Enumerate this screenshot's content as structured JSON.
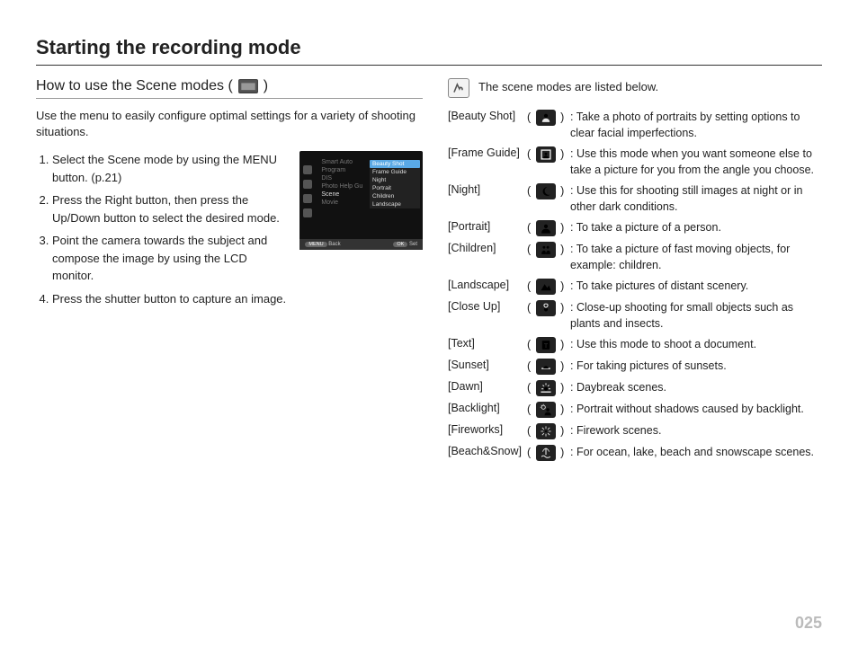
{
  "page_title": "Starting the recording mode",
  "page_number": "025",
  "left": {
    "subheading_prefix": "How to use the Scene modes (",
    "subheading_suffix": ")",
    "intro": "Use the menu to easily configure optimal settings for a variety of shooting situations.",
    "steps": [
      "Select the Scene mode by using the MENU button. (p.21)",
      "Press the Right button, then press the Up/Down button to select the desired mode.",
      "Point the camera towards the subject and compose the image by using the LCD monitor.",
      "Press the shutter button to capture an image."
    ],
    "menu_screenshot": {
      "left_list": [
        "Smart Auto",
        "Program",
        "DIS",
        "Photo Help Gu",
        "Scene",
        "Movie"
      ],
      "left_highlight": "Scene",
      "sub_list": [
        "Beauty Shot",
        "Frame Guide",
        "Night",
        "Portrait",
        "Children",
        "Landscape"
      ],
      "sub_selected": "Beauty Shot",
      "footer_left_btn": "MENU",
      "footer_left": "Back",
      "footer_right_btn": "OK",
      "footer_right": "Set"
    }
  },
  "right": {
    "note": "The scene modes are listed below.",
    "rows": [
      {
        "label": "[Beauty Shot]",
        "icon": "beauty",
        "desc": "Take a photo of portraits by setting options to clear facial imperfections."
      },
      {
        "label": "[Frame Guide]",
        "icon": "frame",
        "desc": "Use this mode when you want someone else to take a picture for you from the angle you choose."
      },
      {
        "label": "[Night]",
        "icon": "night",
        "desc": "Use this for shooting still images at night or in other dark conditions."
      },
      {
        "label": "[Portrait]",
        "icon": "portrait",
        "desc": "To take a picture of a person."
      },
      {
        "label": "[Children]",
        "icon": "children",
        "desc": "To take a picture of fast moving objects, for example: children."
      },
      {
        "label": "[Landscape]",
        "icon": "landscape",
        "desc": "To take pictures of distant scenery."
      },
      {
        "label": "[Close Up]",
        "icon": "closeup",
        "desc": "Close-up shooting for small objects such as plants and insects."
      },
      {
        "label": "[Text]",
        "icon": "text",
        "desc": "Use this mode to shoot a document."
      },
      {
        "label": "[Sunset]",
        "icon": "sunset",
        "desc": "For taking pictures of sunsets."
      },
      {
        "label": "[Dawn]",
        "icon": "dawn",
        "desc": "Daybreak scenes."
      },
      {
        "label": "[Backlight]",
        "icon": "backlight",
        "desc": "Portrait without shadows caused by backlight."
      },
      {
        "label": "[Fireworks]",
        "icon": "fireworks",
        "desc": "Firework scenes."
      },
      {
        "label": "[Beach&Snow]",
        "icon": "beachsnow",
        "desc": "For ocean, lake, beach and snowscape scenes."
      }
    ]
  }
}
